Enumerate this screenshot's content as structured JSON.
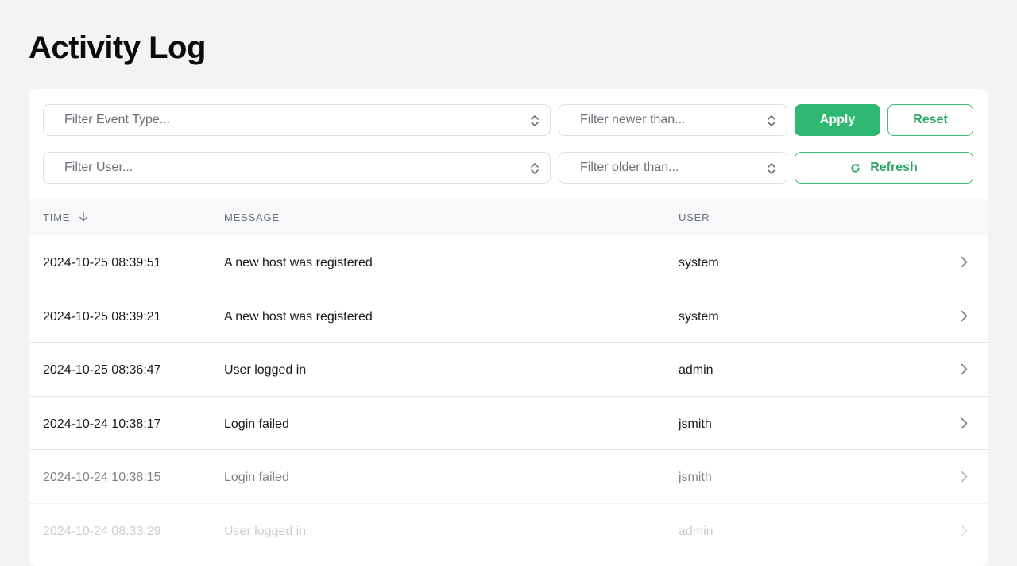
{
  "page": {
    "title": "Activity Log"
  },
  "filters": {
    "event_type_placeholder": "Filter Event Type...",
    "newer_than_placeholder": "Filter newer than...",
    "user_placeholder": "Filter User...",
    "older_than_placeholder": "Filter older than...",
    "apply_label": "Apply",
    "reset_label": "Reset",
    "refresh_label": "Refresh"
  },
  "table": {
    "columns": {
      "time": "TIME",
      "message": "MESSAGE",
      "user": "USER"
    },
    "sort": {
      "column": "time",
      "direction": "descending",
      "icon": "arrow-down-icon"
    },
    "rows": [
      {
        "time": "2024-10-25 08:39:51",
        "message": "A new host was registered",
        "user": "system"
      },
      {
        "time": "2024-10-25 08:39:21",
        "message": "A new host was registered",
        "user": "system"
      },
      {
        "time": "2024-10-25 08:36:47",
        "message": "User logged in",
        "user": "admin"
      },
      {
        "time": "2024-10-24 10:38:17",
        "message": "Login failed",
        "user": "jsmith"
      },
      {
        "time": "2024-10-24 10:38:15",
        "message": "Login failed",
        "user": "jsmith"
      },
      {
        "time": "2024-10-24 08:33:29",
        "message": "User logged in",
        "user": "admin"
      }
    ]
  },
  "colors": {
    "accent": "#2fb872",
    "background": "#f2f3f5",
    "card": "#ffffff"
  },
  "icons": {
    "select": "chevron-up-down-icon",
    "refresh": "refresh-icon",
    "row_action": "chevron-right-icon"
  }
}
